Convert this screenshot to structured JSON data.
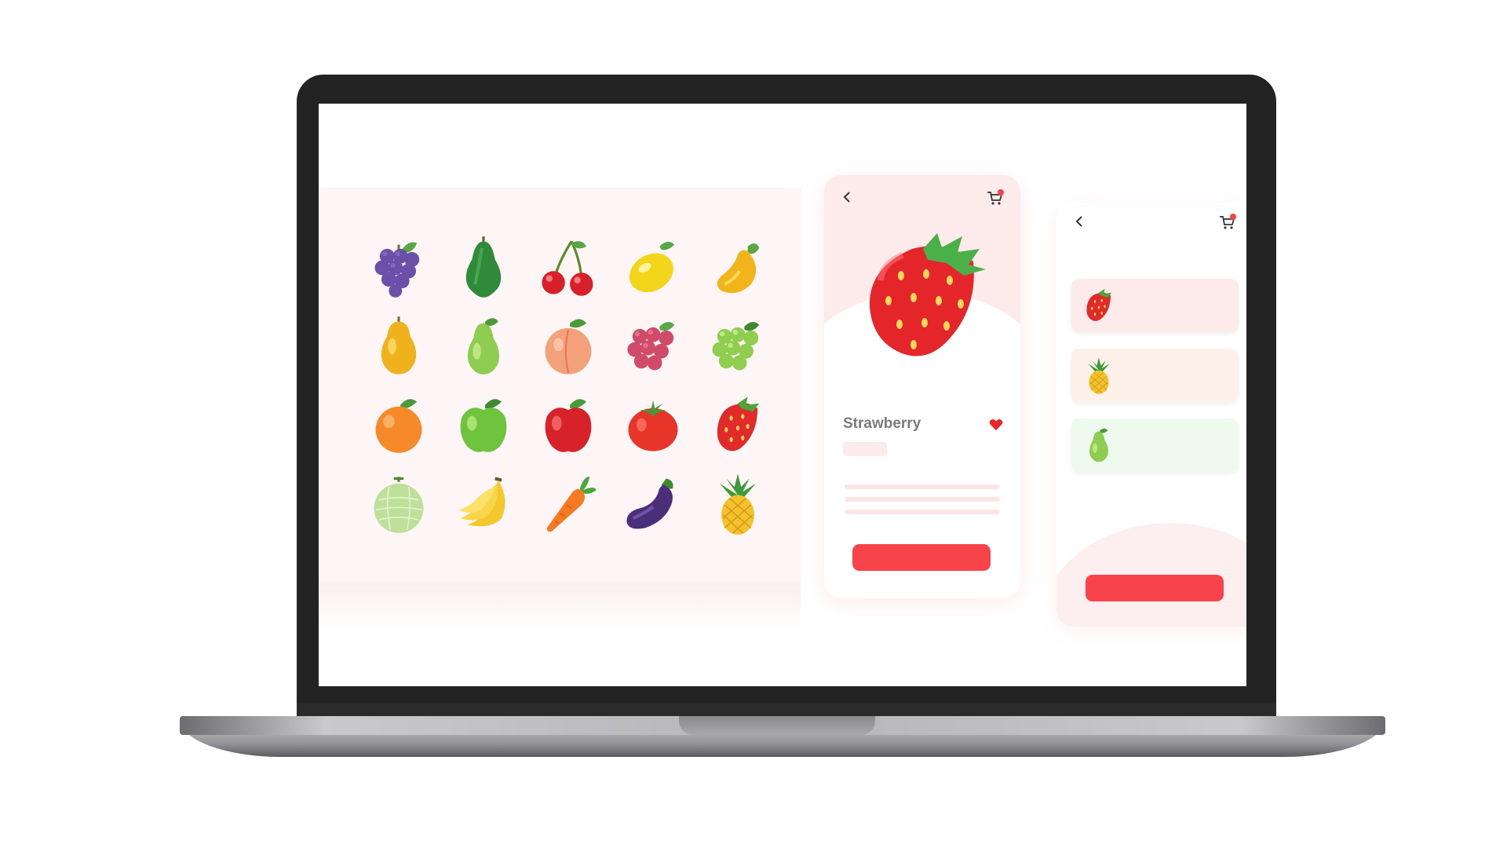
{
  "detail": {
    "product_name": "Strawberry"
  },
  "colors": {
    "accent": "#f8434a",
    "card_tint": "#fdeaea",
    "catalog_bg": "#fef6f6"
  },
  "icons": {
    "back": "chevron-left-icon",
    "cart": "cart-icon",
    "favorite": "heart-icon"
  },
  "catalog": {
    "items": [
      "grapes",
      "avocado",
      "cherries",
      "lemon",
      "mango",
      "yellow-pear",
      "green-pear",
      "peach",
      "red-grapes",
      "green-grapes",
      "orange",
      "green-apple",
      "red-apple",
      "tomato",
      "strawberry",
      "melon",
      "banana",
      "carrot",
      "eggplant",
      "pineapple"
    ]
  },
  "cart": {
    "items": [
      {
        "fruit": "strawberry",
        "tint": "#fdeaea"
      },
      {
        "fruit": "pineapple",
        "tint": "#fdf1ea"
      },
      {
        "fruit": "pear",
        "tint": "#eefaee"
      }
    ]
  }
}
